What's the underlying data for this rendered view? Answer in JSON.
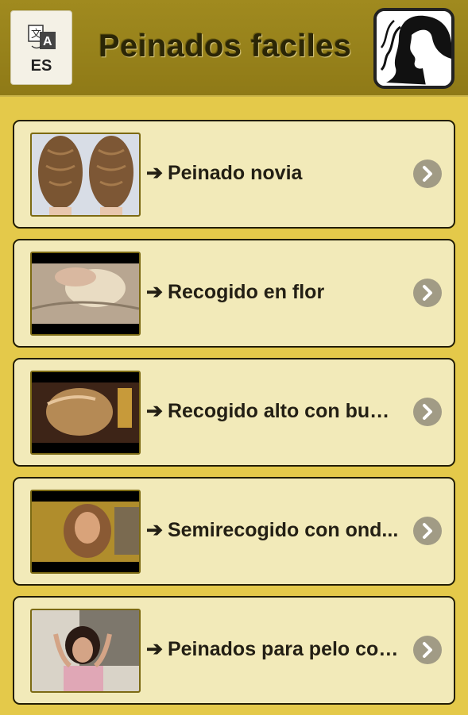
{
  "header": {
    "title": "Peinados faciles",
    "language_code": "ES",
    "translate_icon": "translate-icon",
    "logo_icon": "woman-silhouette-icon"
  },
  "colors": {
    "header_bg": "#998420",
    "page_bg": "#e4c94a",
    "card_bg": "#f2eab9",
    "card_border": "#221d05",
    "chevron_bg": "#a19b85"
  },
  "items": [
    {
      "label": "Peinado novia",
      "prefix": "➔"
    },
    {
      "label": "Recogido en flor",
      "prefix": "➔"
    },
    {
      "label": "Recogido alto con bucl...",
      "prefix": "➔"
    },
    {
      "label": "Semirecogido con ond...",
      "prefix": "➔"
    },
    {
      "label": "Peinados para pelo cor...",
      "prefix": "➔"
    }
  ]
}
